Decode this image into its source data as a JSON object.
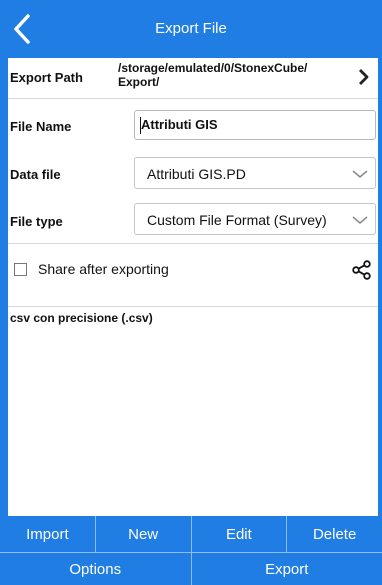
{
  "header": {
    "title": "Export File"
  },
  "export_path": {
    "label": "Export Path",
    "value": "/storage/emulated/0/StonexCube/\nExport/"
  },
  "file_name": {
    "label": "File Name",
    "value": "Attributi GIS"
  },
  "data_file": {
    "label": "Data file",
    "selected": "Attributi GIS.PD"
  },
  "file_type": {
    "label": "File type",
    "selected": "Custom File Format (Survey)"
  },
  "share": {
    "label": "Share after exporting",
    "checked": false
  },
  "formats": [
    "csv con precisione (.csv)"
  ],
  "buttons_row1": [
    "Import",
    "New",
    "Edit",
    "Delete"
  ],
  "buttons_row2": [
    "Options",
    "Export"
  ],
  "colors": {
    "accent": "#1f7de3"
  }
}
